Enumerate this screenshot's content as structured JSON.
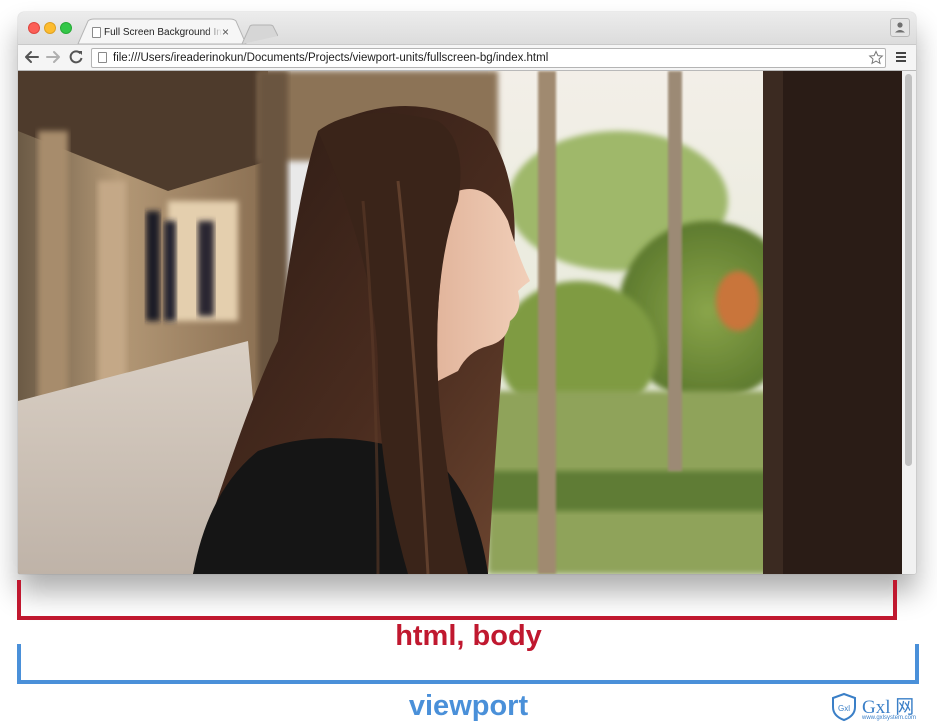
{
  "window": {
    "tab_title": "Full Screen Background Im",
    "tab_close": "×",
    "url": "file:///Users/ireaderinokun/Documents/Projects/viewport-units/fullscreen-bg/index.html"
  },
  "toolbar_icons": [
    "back-arrow-icon",
    "forward-arrow-icon",
    "reload-icon",
    "page-icon",
    "bookmark-star-icon",
    "hamburger-menu-icon"
  ],
  "labels": {
    "html_body": "html, body",
    "viewport": "viewport"
  },
  "watermark": {
    "text": "Gxl 网",
    "url": "www.gxlsystem.com"
  },
  "colors": {
    "html_body_bracket": "#c0182f",
    "viewport_bracket": "#4a90d9"
  }
}
